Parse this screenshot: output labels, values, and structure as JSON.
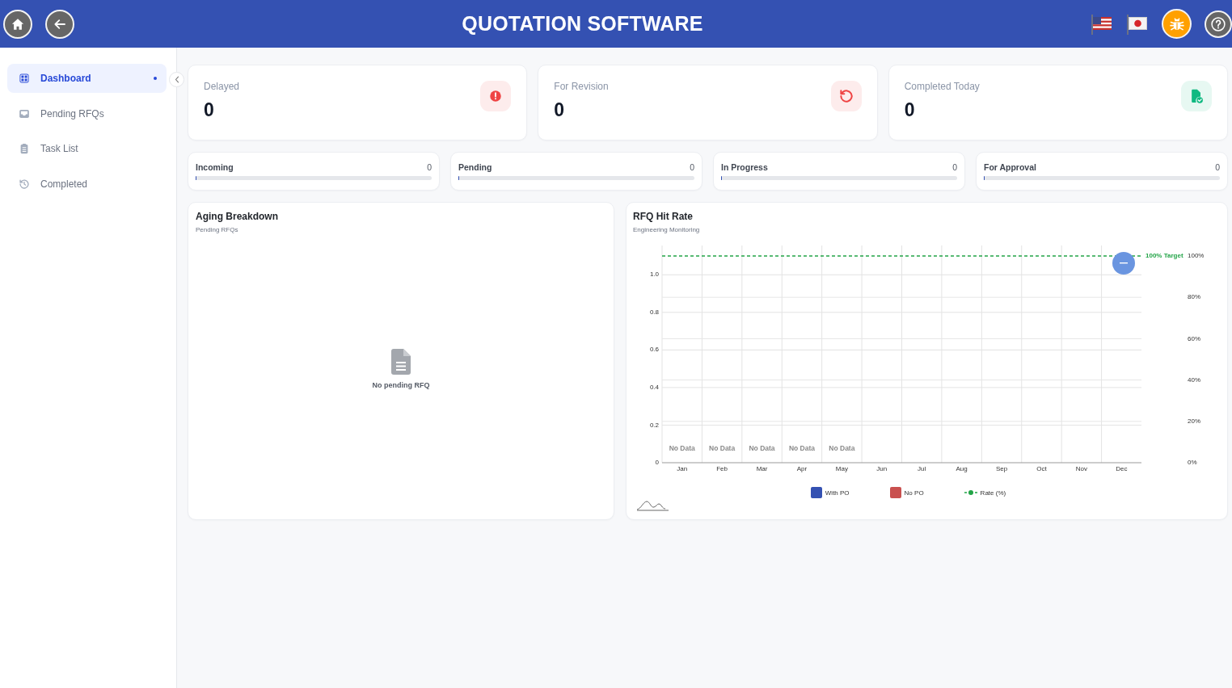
{
  "header": {
    "title": "QUOTATION SOFTWARE"
  },
  "sidebar": {
    "items": [
      {
        "label": "Dashboard",
        "selected": true
      },
      {
        "label": "Pending RFQs",
        "selected": false
      },
      {
        "label": "Task List",
        "selected": false
      },
      {
        "label": "Completed",
        "selected": false
      }
    ]
  },
  "stat_cards": [
    {
      "label": "Delayed",
      "value": "0",
      "color": "#ef4444"
    },
    {
      "label": "For Revision",
      "value": "0",
      "color": "#ef4444"
    },
    {
      "label": "Completed Today",
      "value": "0",
      "color": "#10b981"
    }
  ],
  "status_tiles": [
    {
      "label": "Incoming",
      "count": "0",
      "level": 0
    },
    {
      "label": "Pending",
      "count": "0",
      "level": 0
    },
    {
      "label": "In Progress",
      "count": "0",
      "level": 0
    },
    {
      "label": "For Approval",
      "count": "0",
      "level": 0
    }
  ],
  "aging_breakdown": {
    "title": "Aging Breakdown",
    "subtitle": "Pending RFQs",
    "empty_message": "No pending RFQ"
  },
  "hit_rate": {
    "title": "RFQ Hit Rate",
    "subtitle": "Engineering Monitoring",
    "chart_data": {
      "type": "bar",
      "categories": [
        "Jan",
        "Feb",
        "Mar",
        "Apr",
        "May",
        "Jun",
        "Jul",
        "Aug",
        "Sep",
        "Oct",
        "Nov",
        "Dec"
      ],
      "series": [
        {
          "name": "With PO",
          "color": "#3451b2",
          "values": [
            null,
            null,
            null,
            null,
            null,
            null,
            null,
            null,
            null,
            null,
            null,
            null
          ]
        },
        {
          "name": "No PO",
          "color": "#c9504f",
          "values": [
            null,
            null,
            null,
            null,
            null,
            null,
            null,
            null,
            null,
            null,
            null,
            null
          ]
        },
        {
          "name": "Rate (%)",
          "type": "line",
          "color": "#22a447",
          "values": [
            null,
            null,
            null,
            null,
            null,
            null,
            null,
            null,
            null,
            null,
            null,
            null
          ]
        }
      ],
      "grid": true,
      "ylim": [
        0,
        1.1
      ],
      "yticks": [
        0,
        0.2,
        0.4,
        0.6,
        0.8,
        {
          "value": 1,
          "label": "1.0"
        }
      ],
      "y2lim": [
        0,
        100
      ],
      "y2ticks": [
        {
          "value": 0,
          "label": "0%"
        },
        {
          "value": 20,
          "label": "20%"
        },
        {
          "value": 40,
          "label": "40%"
        },
        {
          "value": 60,
          "label": "60%"
        },
        {
          "value": 80,
          "label": "80%"
        },
        {
          "value": 100,
          "label": "100%"
        }
      ],
      "ref_lines": [
        {
          "axis": "y2",
          "value": 100,
          "label": "100% Target",
          "color": "#22a447"
        }
      ],
      "annotations": [
        "No Data",
        "No Data",
        "No Data",
        "No Data",
        "No Data"
      ]
    }
  }
}
